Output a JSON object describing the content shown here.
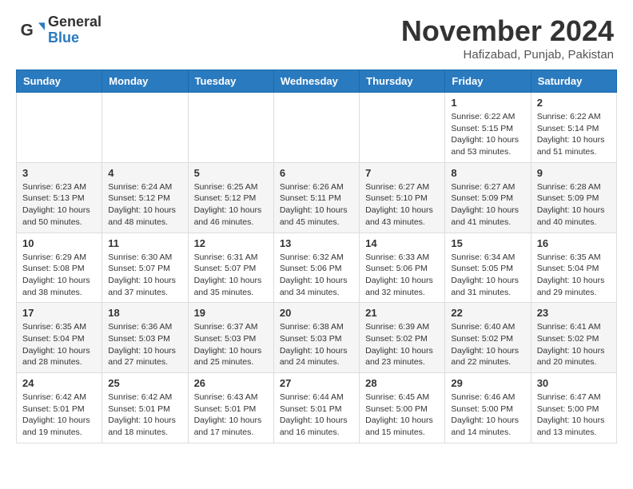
{
  "header": {
    "logo_general": "General",
    "logo_blue": "Blue",
    "month_title": "November 2024",
    "location": "Hafizabad, Punjab, Pakistan"
  },
  "weekdays": [
    "Sunday",
    "Monday",
    "Tuesday",
    "Wednesday",
    "Thursday",
    "Friday",
    "Saturday"
  ],
  "weeks": [
    [
      {
        "day": "",
        "info": ""
      },
      {
        "day": "",
        "info": ""
      },
      {
        "day": "",
        "info": ""
      },
      {
        "day": "",
        "info": ""
      },
      {
        "day": "",
        "info": ""
      },
      {
        "day": "1",
        "info": "Sunrise: 6:22 AM\nSunset: 5:15 PM\nDaylight: 10 hours and 53 minutes."
      },
      {
        "day": "2",
        "info": "Sunrise: 6:22 AM\nSunset: 5:14 PM\nDaylight: 10 hours and 51 minutes."
      }
    ],
    [
      {
        "day": "3",
        "info": "Sunrise: 6:23 AM\nSunset: 5:13 PM\nDaylight: 10 hours and 50 minutes."
      },
      {
        "day": "4",
        "info": "Sunrise: 6:24 AM\nSunset: 5:12 PM\nDaylight: 10 hours and 48 minutes."
      },
      {
        "day": "5",
        "info": "Sunrise: 6:25 AM\nSunset: 5:12 PM\nDaylight: 10 hours and 46 minutes."
      },
      {
        "day": "6",
        "info": "Sunrise: 6:26 AM\nSunset: 5:11 PM\nDaylight: 10 hours and 45 minutes."
      },
      {
        "day": "7",
        "info": "Sunrise: 6:27 AM\nSunset: 5:10 PM\nDaylight: 10 hours and 43 minutes."
      },
      {
        "day": "8",
        "info": "Sunrise: 6:27 AM\nSunset: 5:09 PM\nDaylight: 10 hours and 41 minutes."
      },
      {
        "day": "9",
        "info": "Sunrise: 6:28 AM\nSunset: 5:09 PM\nDaylight: 10 hours and 40 minutes."
      }
    ],
    [
      {
        "day": "10",
        "info": "Sunrise: 6:29 AM\nSunset: 5:08 PM\nDaylight: 10 hours and 38 minutes."
      },
      {
        "day": "11",
        "info": "Sunrise: 6:30 AM\nSunset: 5:07 PM\nDaylight: 10 hours and 37 minutes."
      },
      {
        "day": "12",
        "info": "Sunrise: 6:31 AM\nSunset: 5:07 PM\nDaylight: 10 hours and 35 minutes."
      },
      {
        "day": "13",
        "info": "Sunrise: 6:32 AM\nSunset: 5:06 PM\nDaylight: 10 hours and 34 minutes."
      },
      {
        "day": "14",
        "info": "Sunrise: 6:33 AM\nSunset: 5:06 PM\nDaylight: 10 hours and 32 minutes."
      },
      {
        "day": "15",
        "info": "Sunrise: 6:34 AM\nSunset: 5:05 PM\nDaylight: 10 hours and 31 minutes."
      },
      {
        "day": "16",
        "info": "Sunrise: 6:35 AM\nSunset: 5:04 PM\nDaylight: 10 hours and 29 minutes."
      }
    ],
    [
      {
        "day": "17",
        "info": "Sunrise: 6:35 AM\nSunset: 5:04 PM\nDaylight: 10 hours and 28 minutes."
      },
      {
        "day": "18",
        "info": "Sunrise: 6:36 AM\nSunset: 5:03 PM\nDaylight: 10 hours and 27 minutes."
      },
      {
        "day": "19",
        "info": "Sunrise: 6:37 AM\nSunset: 5:03 PM\nDaylight: 10 hours and 25 minutes."
      },
      {
        "day": "20",
        "info": "Sunrise: 6:38 AM\nSunset: 5:03 PM\nDaylight: 10 hours and 24 minutes."
      },
      {
        "day": "21",
        "info": "Sunrise: 6:39 AM\nSunset: 5:02 PM\nDaylight: 10 hours and 23 minutes."
      },
      {
        "day": "22",
        "info": "Sunrise: 6:40 AM\nSunset: 5:02 PM\nDaylight: 10 hours and 22 minutes."
      },
      {
        "day": "23",
        "info": "Sunrise: 6:41 AM\nSunset: 5:02 PM\nDaylight: 10 hours and 20 minutes."
      }
    ],
    [
      {
        "day": "24",
        "info": "Sunrise: 6:42 AM\nSunset: 5:01 PM\nDaylight: 10 hours and 19 minutes."
      },
      {
        "day": "25",
        "info": "Sunrise: 6:42 AM\nSunset: 5:01 PM\nDaylight: 10 hours and 18 minutes."
      },
      {
        "day": "26",
        "info": "Sunrise: 6:43 AM\nSunset: 5:01 PM\nDaylight: 10 hours and 17 minutes."
      },
      {
        "day": "27",
        "info": "Sunrise: 6:44 AM\nSunset: 5:01 PM\nDaylight: 10 hours and 16 minutes."
      },
      {
        "day": "28",
        "info": "Sunrise: 6:45 AM\nSunset: 5:00 PM\nDaylight: 10 hours and 15 minutes."
      },
      {
        "day": "29",
        "info": "Sunrise: 6:46 AM\nSunset: 5:00 PM\nDaylight: 10 hours and 14 minutes."
      },
      {
        "day": "30",
        "info": "Sunrise: 6:47 AM\nSunset: 5:00 PM\nDaylight: 10 hours and 13 minutes."
      }
    ]
  ]
}
